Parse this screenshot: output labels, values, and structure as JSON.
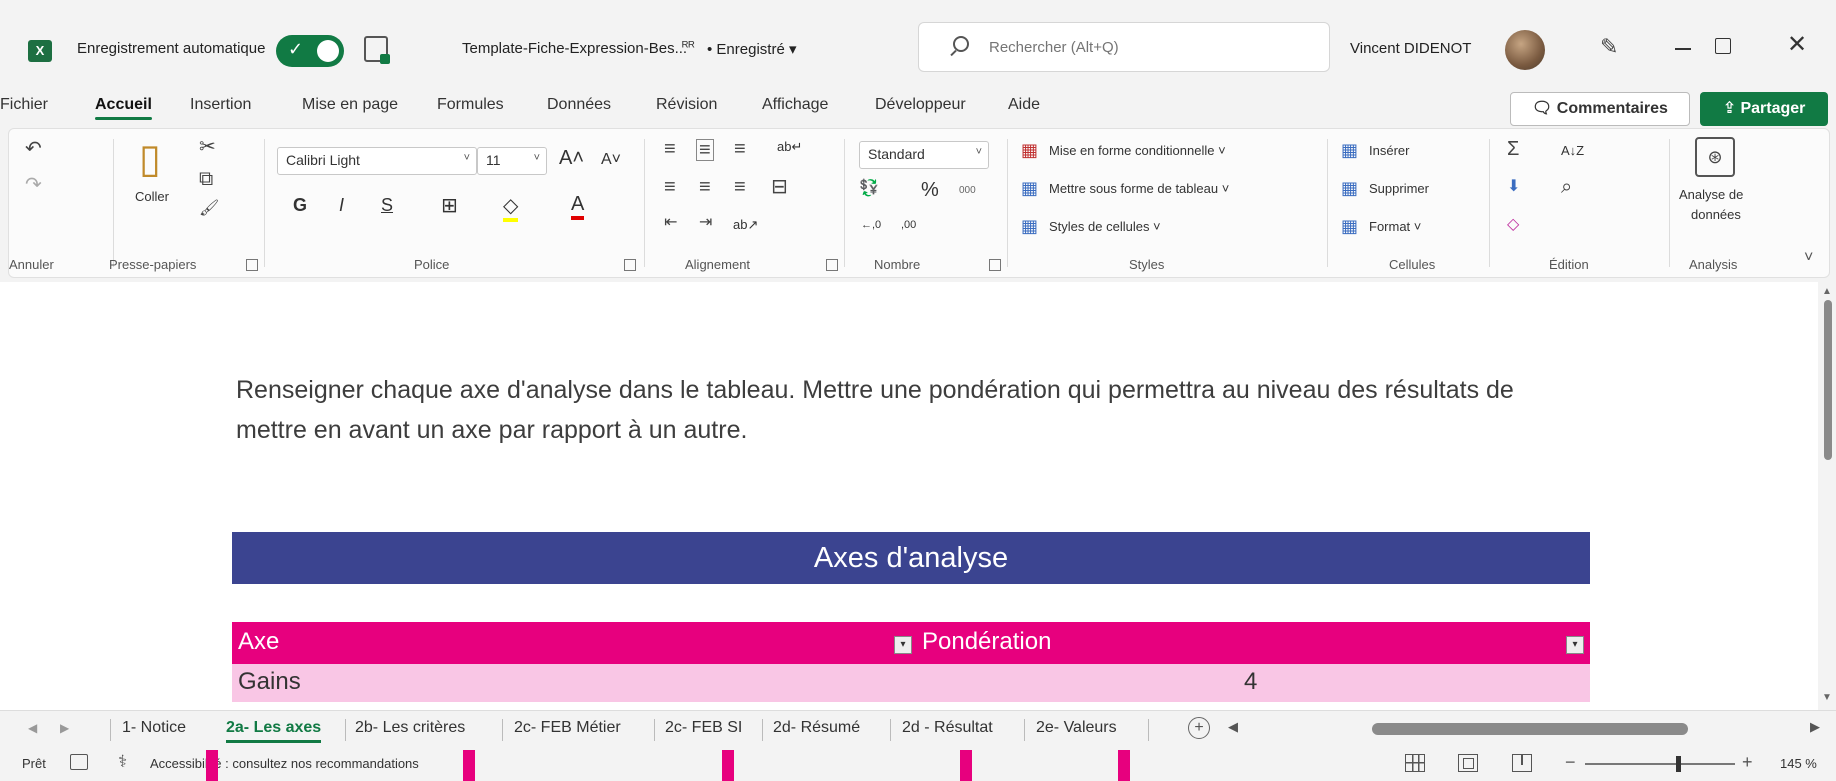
{
  "titlebar": {
    "logo": "X",
    "autosave_label": "Enregistrement automatique",
    "autosave_check": "✓",
    "doc_title": "Template-Fiche-Expression-Bes...",
    "share_glyph": "ᴿᴿ",
    "saved_status": "• Enregistré ▾",
    "search_placeholder": "Rechercher (Alt+Q)",
    "user_name": "Vincent DIDENOT",
    "pen_glyph": "✎",
    "close_glyph": "✕"
  },
  "menu": {
    "tabs": [
      "Fichier",
      "Accueil",
      "Insertion",
      "Mise en page",
      "Formules",
      "Données",
      "Révision",
      "Affichage",
      "Développeur",
      "Aide"
    ],
    "active": "Accueil",
    "comments_label": "🗨 Commentaires",
    "share_label": "⇪ Partager"
  },
  "ribbon": {
    "undo_group": {
      "label": "Annuler",
      "undo": "↶",
      "redo": "↷"
    },
    "clipboard": {
      "label": "Presse-papiers",
      "paste_label": "Coller",
      "cut": "✂",
      "copy": "⧉",
      "brush": "🖌"
    },
    "font": {
      "label": "Police",
      "font_name": "Calibri Light",
      "font_size": "11",
      "grow": "A˄",
      "shrink": "A˅",
      "bold": "G",
      "italic": "I",
      "underline": "S",
      "borders": "⊞",
      "fill": "◇",
      "color": "A"
    },
    "alignment": {
      "label": "Alignement",
      "wrap": "ab↵",
      "merge": "⊟",
      "orientation": "ab↗"
    },
    "number": {
      "label": "Nombre",
      "format": "Standard",
      "currency": "💱",
      "percent": "%",
      "thousands": "000",
      "inc_dec": "←,0",
      "dec_dec": ",00"
    },
    "styles": {
      "label": "Styles",
      "conditional": "Mise en forme conditionnelle ˅",
      "as_table": "Mettre sous forme de tableau ˅",
      "cell_styles": "Styles de cellules ˅"
    },
    "cells": {
      "label": "Cellules",
      "insert": "Insérer",
      "delete": "Supprimer",
      "format": "Format ˅"
    },
    "edition": {
      "label": "Édition",
      "sum": "Σ",
      "sort": "A↓Z",
      "fill": "⬇",
      "find": "⌕",
      "clear": "◇"
    },
    "analysis": {
      "label": "Analysis",
      "button": "Analyse de",
      "button2": "données"
    },
    "collapse": "˅"
  },
  "sheet": {
    "instruction": "Renseigner chaque axe d'analyse dans le tableau. Mettre une pondération qui permettra au niveau des résultats de mettre en avant un axe par rapport à un autre.",
    "banner": "Axes d'analyse",
    "table": {
      "headers": [
        "Axe",
        "Pondération"
      ],
      "rows": [
        [
          "Gains",
          "4"
        ]
      ]
    }
  },
  "tabs": {
    "nav_prev": "◀",
    "nav_next": "▶",
    "items": [
      "1- Notice",
      "2a- Les axes",
      "2b- Les critères",
      "2c- FEB Métier",
      "2c- FEB SI",
      "2d- Résumé",
      "2d - Résultat",
      "2e- Valeurs"
    ],
    "active": "2a- Les axes",
    "add": "+"
  },
  "status": {
    "ready": "Prêt",
    "accessibility_icon": "⚕",
    "accessibility": "Accessibilité : consultez nos recommandations",
    "zoom": "145 %"
  },
  "colors": {
    "accent": "#117a44",
    "banner": "#3b4490",
    "table_header": "#e7007e",
    "table_row": "#f9c6e5"
  }
}
